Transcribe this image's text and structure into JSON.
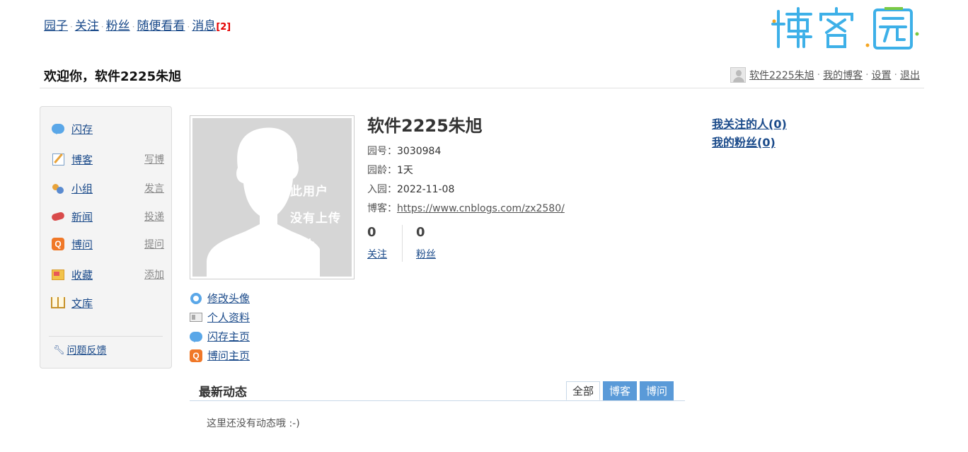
{
  "topnav": {
    "items": [
      "园子",
      "关注",
      "粉丝",
      "随便看看",
      "消息"
    ],
    "message_count": "[2]"
  },
  "logo": {
    "text": "博客园"
  },
  "welcome": "欢迎你，软件2225朱旭",
  "userbar": {
    "username": "软件2225朱旭",
    "my_blog": "我的博客",
    "settings": "设置",
    "logout": "退出"
  },
  "sidebar": {
    "items": [
      {
        "label": "闪存",
        "sub": "",
        "icon": "flash-icon"
      },
      {
        "label": "博客",
        "sub": "写博",
        "icon": "blog-icon"
      },
      {
        "label": "小组",
        "sub": "发言",
        "icon": "group-icon"
      },
      {
        "label": "新闻",
        "sub": "投递",
        "icon": "news-icon"
      },
      {
        "label": "博问",
        "sub": "提问",
        "icon": "question-icon"
      },
      {
        "label": "收藏",
        "sub": "添加",
        "icon": "favorite-icon"
      },
      {
        "label": "文库",
        "sub": "",
        "icon": "library-icon"
      }
    ],
    "feedback": "问题反馈"
  },
  "profile": {
    "avatar_text": [
      "此用户",
      "没有上传",
      "照片"
    ],
    "name": "软件2225朱旭",
    "id_label": "园号：",
    "id_value": "3030984",
    "age_label": "园龄：",
    "age_value": "1天",
    "joined_label": "入园：",
    "joined_value": "2022-11-08",
    "blog_label": "博客：",
    "blog_url": "https://www.cnblogs.com/zx2580/",
    "following_count": "0",
    "following_label": "关注",
    "followers_count": "0",
    "followers_label": "粉丝"
  },
  "actions": [
    "修改头像",
    "个人资料",
    "闪存主页",
    "博问主页"
  ],
  "right": {
    "my_following": "我关注的人(0)",
    "my_followers": "我的粉丝(0)"
  },
  "feed": {
    "title": "最新动态",
    "tabs": [
      "全部",
      "博客",
      "博问"
    ],
    "active_tab": "全部",
    "empty_text": "这里还没有动态哦 :-)"
  },
  "colors": {
    "link": "#1a4a8a",
    "tab_bg": "#5a9ad8",
    "message_count": "#e40000",
    "logo_blue": "#3db0e8",
    "logo_green": "#7ac943",
    "logo_orange": "#f5a623"
  }
}
